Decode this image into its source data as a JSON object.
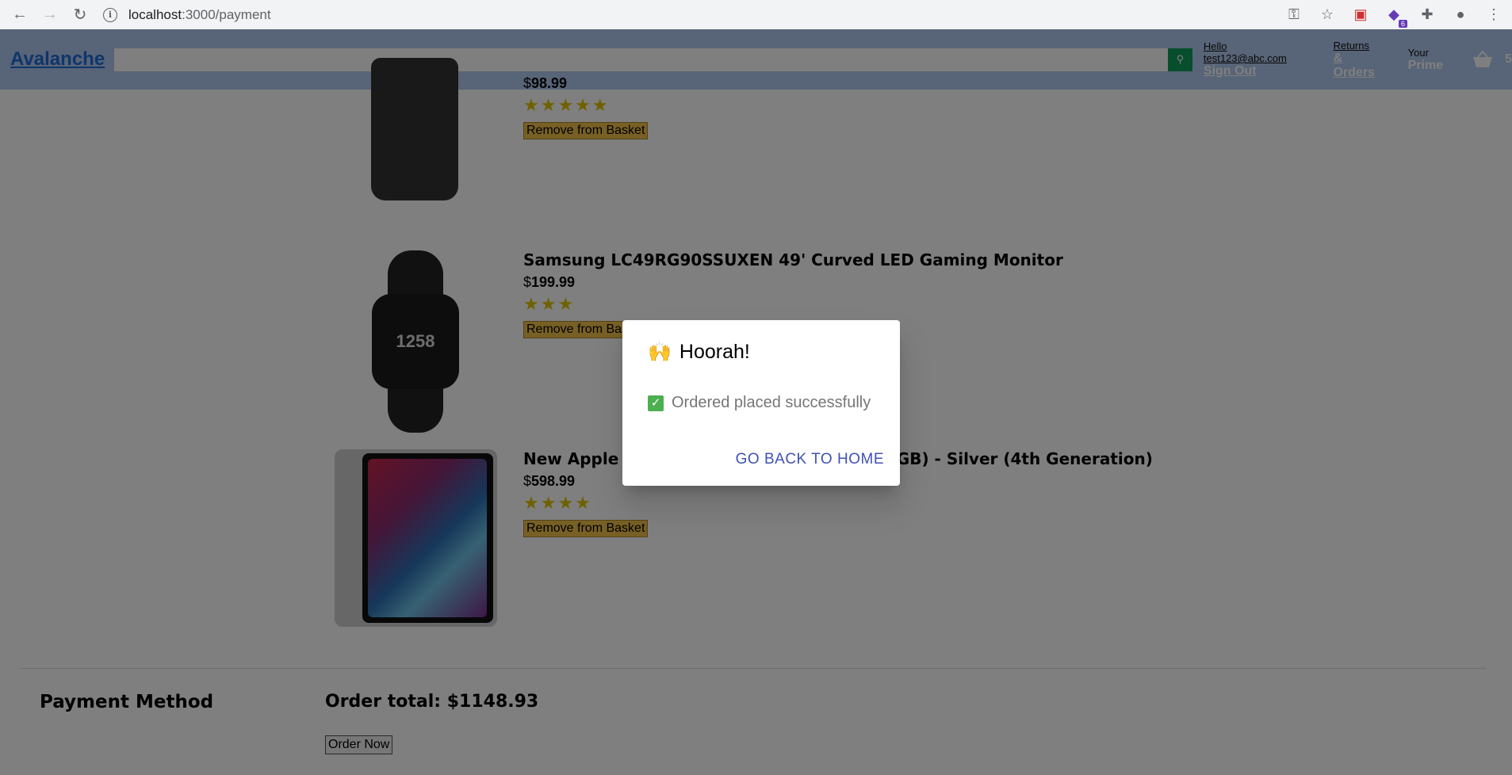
{
  "browser": {
    "url_host": "localhost",
    "url_path": ":3000/payment",
    "extension_badge": "6"
  },
  "header": {
    "logo": "Avalanche",
    "greeting": "Hello test123@abc.com",
    "sign_out": "Sign Out",
    "returns_l1": "Returns",
    "returns_l2": "& Orders",
    "your_l1": "Your",
    "your_l2": "Prime",
    "basket_count": "5"
  },
  "products": [
    {
      "title": "",
      "price_symbol": "$",
      "price": "98.99",
      "stars": "★★★★★",
      "remove_label": "Remove from Basket"
    },
    {
      "title": "Samsung LC49RG90SSUXEN 49' Curved LED Gaming Monitor",
      "price_symbol": "$",
      "price": "199.99",
      "stars": "★★★",
      "remove_label": "Remove from Basket",
      "watch_face_text": "1258"
    },
    {
      "title": "New Apple iPad Pro (12.9-inch, Wi-Fi, 128GB) - Silver (4th Generation)",
      "price_symbol": "$",
      "price": "598.99",
      "stars": "★★★★",
      "remove_label": "Remove from Basket"
    }
  ],
  "checkout": {
    "payment_method": "Payment Method",
    "order_total": "Order total: $1148.93",
    "order_now": "Order Now"
  },
  "modal": {
    "emoji": "🙌",
    "title": "Hoorah!",
    "check": "✓",
    "message": "Ordered placed successfully",
    "action": "GO BACK TO HOME"
  }
}
